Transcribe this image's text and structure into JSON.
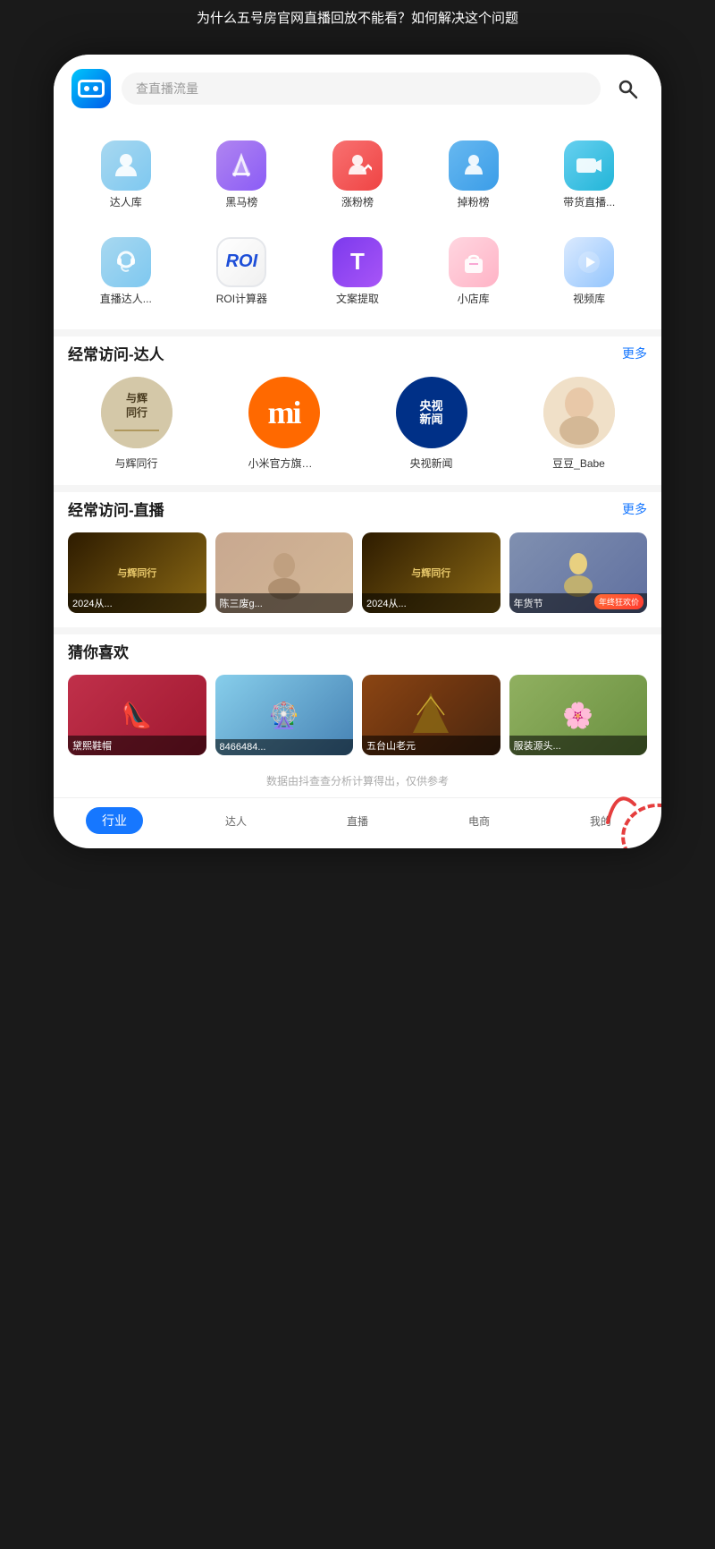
{
  "topBar": {
    "title": "为什么五号房官网直播回放不能看？如何解决这个问题"
  },
  "header": {
    "searchPlaceholder": "查直播流量"
  },
  "icons": {
    "row1": [
      {
        "id": "talent",
        "label": "达人库",
        "colorClass": "icon-talent",
        "emoji": "👤"
      },
      {
        "id": "blackhorse",
        "label": "黑马榜",
        "colorClass": "icon-blackhorse",
        "emoji": "🏆"
      },
      {
        "id": "fans-up",
        "label": "涨粉榜",
        "colorClass": "icon-fans-up",
        "emoji": "📈"
      },
      {
        "id": "fans-down",
        "label": "掉粉榜",
        "colorClass": "icon-fans-down",
        "emoji": "📉"
      },
      {
        "id": "live",
        "label": "带货直播...",
        "colorClass": "icon-live",
        "emoji": "🎬"
      }
    ],
    "row2": [
      {
        "id": "live-talent",
        "label": "直播达人...",
        "colorClass": "icon-live-talent",
        "emoji": "🎙"
      },
      {
        "id": "roi",
        "label": "ROI计算器",
        "colorClass": "icon-roi",
        "text": "ROI"
      },
      {
        "id": "copy",
        "label": "文案提取",
        "colorClass": "icon-copy",
        "text": "T"
      },
      {
        "id": "shop",
        "label": "小店库",
        "colorClass": "icon-shop",
        "emoji": "🛍"
      },
      {
        "id": "video",
        "label": "视频库",
        "colorClass": "icon-video",
        "emoji": "▶"
      }
    ]
  },
  "frequentTalent": {
    "sectionTitle": "经常访问-达人",
    "moreLabel": "更多",
    "items": [
      {
        "id": "yuhui",
        "name": "与辉同行",
        "text": "与辉同行",
        "bgClass": "av-yuhui"
      },
      {
        "id": "xiaomi",
        "name": "小米官方旗舰店",
        "text": "mi",
        "bgClass": "av-xiaomi"
      },
      {
        "id": "cctv",
        "name": "央视新闻",
        "text": "央视\n新闻",
        "bgClass": "av-cctv"
      },
      {
        "id": "doudou",
        "name": "豆豆_Babe",
        "text": "👩",
        "bgClass": "av-doudou"
      }
    ]
  },
  "frequentLive": {
    "sectionTitle": "经常访问-直播",
    "moreLabel": "更多",
    "items": [
      {
        "id": "live1",
        "label": "2024从...",
        "bgClass": "live-bg1",
        "text": "与辉同行"
      },
      {
        "id": "live2",
        "label": "陈三废g...",
        "bgClass": "live-bg2",
        "text": "👩"
      },
      {
        "id": "live3",
        "label": "2024从...",
        "bgClass": "live-bg3",
        "text": "与辉同行"
      },
      {
        "id": "live4",
        "label": "年货节",
        "bgClass": "live-bg4",
        "text": "🛍",
        "badge": "年终狂欢价"
      }
    ]
  },
  "guessLike": {
    "sectionTitle": "猜你喜欢",
    "items": [
      {
        "id": "guess1",
        "label": "黛熙鞋帽",
        "bgClass": "guess-bg1",
        "text": "👠"
      },
      {
        "id": "guess2",
        "label": "8466484...",
        "bgClass": "guess-bg2",
        "text": "🎡"
      },
      {
        "id": "guess3",
        "label": "五台山老元",
        "bgClass": "guess-bg3",
        "text": "🏔"
      },
      {
        "id": "guess4",
        "label": "服装源头...",
        "bgClass": "guess-bg4",
        "text": "🌸"
      }
    ]
  },
  "footerNote": "数据由抖查查分析计算得出，仅供参考",
  "bottomNav": {
    "items": [
      {
        "id": "industry",
        "label": "行业",
        "active": true
      },
      {
        "id": "talent",
        "label": "达人",
        "active": false
      },
      {
        "id": "live",
        "label": "直播",
        "active": false
      },
      {
        "id": "ecommerce",
        "label": "电商",
        "active": false
      },
      {
        "id": "mine",
        "label": "我的",
        "active": false
      }
    ]
  }
}
